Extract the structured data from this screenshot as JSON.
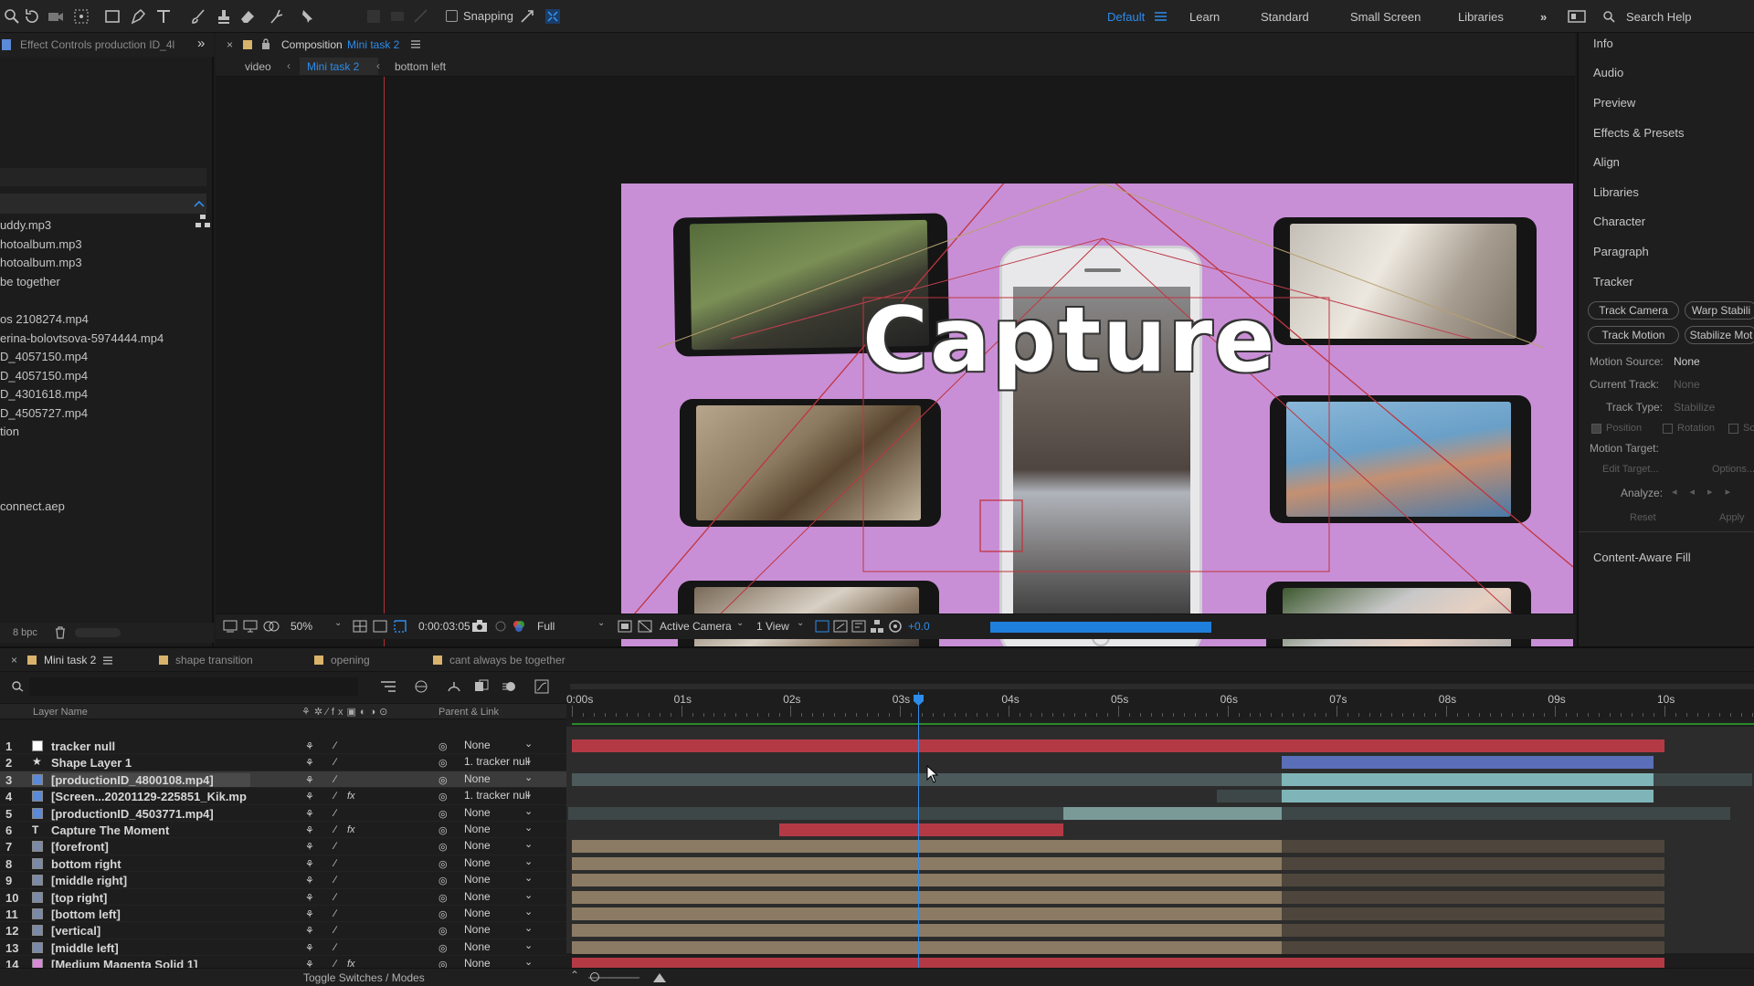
{
  "toolbar": {
    "snapping_label": "Snapping",
    "workspaces": [
      "Default",
      "Learn",
      "Standard",
      "Small Screen",
      "Libraries"
    ],
    "active_workspace": "Default",
    "search_help": "Search Help"
  },
  "left_panel": {
    "tab_label": "Effect Controls production ID_4l",
    "items": [
      "uddy.mp3",
      "hotoalbum.mp3",
      "hotoalbum.mp3",
      "be together",
      "",
      "os 2108274.mp4",
      "erina-bolovtsova-5974444.mp4",
      "D_4057150.mp4",
      "D_4057150.mp4",
      "D_4301618.mp4",
      "D_4505727.mp4",
      "tion",
      "",
      "",
      "connect.aep"
    ],
    "bpc_label": "8 bpc"
  },
  "composition": {
    "tab_prefix": "Composition",
    "tab_name": "Mini task 2",
    "breadcrumbs": [
      "video",
      "Mini task 2",
      "bottom left"
    ],
    "title_text": "Capture",
    "zoom": "50%",
    "timecode": "0:00:03:05",
    "resolution": "Full",
    "camera": "Active Camera",
    "views": "1 View",
    "exposure": "+0.0"
  },
  "right_panel": {
    "items": [
      "Info",
      "Audio",
      "Preview",
      "Effects & Presets",
      "Align",
      "Libraries",
      "Character",
      "Paragraph",
      "Tracker"
    ],
    "tracker_buttons": [
      "Track Camera",
      "Warp Stabili",
      "Track Motion",
      "Stabilize Mot"
    ],
    "motion_source_label": "Motion Source:",
    "motion_source_value": "None",
    "current_track_label": "Current Track:",
    "current_track_value": "None",
    "track_type_label": "Track Type:",
    "track_type_value": "Stabilize",
    "checks": [
      "Position",
      "Rotation",
      "Sc"
    ],
    "motion_target_label": "Motion Target:",
    "edit_target": "Edit Target...",
    "options": "Options...",
    "analyze_label": "Analyze:",
    "reset": "Reset",
    "apply": "Apply",
    "content_aware": "Content-Aware Fill"
  },
  "timeline": {
    "tabs": [
      {
        "label": "Mini task 2",
        "color": "#d9b36b"
      },
      {
        "label": "shape transition",
        "color": "#d9b36b"
      },
      {
        "label": "opening",
        "color": "#d9b36b"
      },
      {
        "label": "cant always be together",
        "color": "#d9b36b"
      }
    ],
    "col_layer_name": "Layer Name",
    "col_parent": "Parent & Link",
    "ruler_labels": [
      "0:00s",
      "01s",
      "02s",
      "03s",
      "04s",
      "05s",
      "06s",
      "07s",
      "08s",
      "09s",
      "10s"
    ],
    "footer_label": "Toggle Switches / Modes",
    "layers": [
      {
        "num": "1",
        "name": "tracker null",
        "icon": "#ffffff",
        "parent": "None",
        "fx": "",
        "bar_color": "#b33a45"
      },
      {
        "num": "2",
        "name": "Shape Layer 1",
        "icon": "#b8b8b8",
        "parent": "1. tracker null",
        "fx": "",
        "bar_color": "#5a6fb8"
      },
      {
        "num": "3",
        "name": "[productionID_4800108.mp4]",
        "icon": "#5a8ad8",
        "parent": "None",
        "fx": "",
        "bar_color": "#7fb5b8"
      },
      {
        "num": "4",
        "name": "[Screen...20201129-225851_Kik.mp",
        "icon": "#5a8ad8",
        "parent": "1. tracker null",
        "fx": "fx",
        "bar_color": "#7fb5b8"
      },
      {
        "num": "5",
        "name": "[productionID_4503771.mp4]",
        "icon": "#5a8ad8",
        "parent": "None",
        "fx": "",
        "bar_color": "#7fb5b8"
      },
      {
        "num": "6",
        "name": "Capture  The Moment",
        "icon": "T",
        "parent": "None",
        "fx": "fx",
        "bar_color": "#b33a45"
      },
      {
        "num": "7",
        "name": "[forefront]",
        "icon": "#7a8aa8",
        "parent": "None",
        "fx": "",
        "bar_color": "#8c7b64"
      },
      {
        "num": "8",
        "name": "bottom right",
        "icon": "#7a8aa8",
        "parent": "None",
        "fx": "",
        "bar_color": "#8c7b64"
      },
      {
        "num": "9",
        "name": "[middle right]",
        "icon": "#7a8aa8",
        "parent": "None",
        "fx": "",
        "bar_color": "#8c7b64"
      },
      {
        "num": "10",
        "name": "[top right]",
        "icon": "#7a8aa8",
        "parent": "None",
        "fx": "",
        "bar_color": "#8c7b64"
      },
      {
        "num": "11",
        "name": "[bottom left]",
        "icon": "#7a8aa8",
        "parent": "None",
        "fx": "",
        "bar_color": "#8c7b64"
      },
      {
        "num": "12",
        "name": "[vertical]",
        "icon": "#7a8aa8",
        "parent": "None",
        "fx": "",
        "bar_color": "#8c7b64"
      },
      {
        "num": "13",
        "name": "[middle left]",
        "icon": "#7a8aa8",
        "parent": "None",
        "fx": "",
        "bar_color": "#8c7b64"
      },
      {
        "num": "14",
        "name": "[Medium Magenta Solid 1]",
        "icon": "#d88ad8",
        "parent": "None",
        "fx": "fx",
        "bar_color": "#b33a45"
      }
    ]
  },
  "colors": {
    "accent": "#2d8ceb",
    "canvas_bg": "#c98fd6",
    "playhead": "#2d8ceb"
  }
}
